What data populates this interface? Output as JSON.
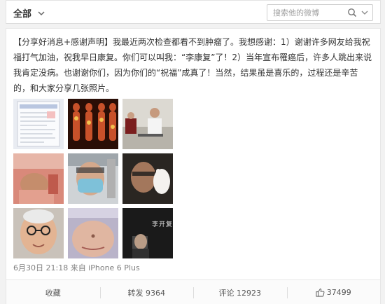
{
  "topbar": {
    "filter_label": "全部",
    "search_placeholder": "搜索他的微博"
  },
  "post": {
    "text": "【分享好消息+感谢声明】我最近两次检查都看不到肿瘤了。我想感谢：1）谢谢许多网友给我祝福打气加油，祝我早日康复。你们可以叫我：“李康复”了！2）当年宣布罹癌后，许多人跳出来说我肯定没病。也谢谢你们，因为你们的“祝福”成真了！当然，结果虽是喜乐的，过程还是辛苦的，和大家分享几张照片。",
    "meta": "6月30日 21:18 来自 iPhone 6 Plus",
    "photos": [
      {
        "name": "medical-report-photo"
      },
      {
        "name": "pet-scan-photo"
      },
      {
        "name": "hospital-visit-photo"
      },
      {
        "name": "hospital-bed-selfie-photo"
      },
      {
        "name": "masked-selfie-photo"
      },
      {
        "name": "portrait-hand-photo"
      },
      {
        "name": "bald-glasses-selfie-photo"
      },
      {
        "name": "abdomen-scar-photo"
      },
      {
        "name": "book-cover-photo"
      }
    ],
    "book_cover_text": "李开复"
  },
  "actions": {
    "favorite": "收藏",
    "repost": "转发 9364",
    "comment": "评论 12923",
    "like_count": "37499"
  },
  "colors": {
    "background": "#f2f2f2",
    "card": "#ffffff",
    "text": "#333333",
    "meta": "#808080"
  }
}
